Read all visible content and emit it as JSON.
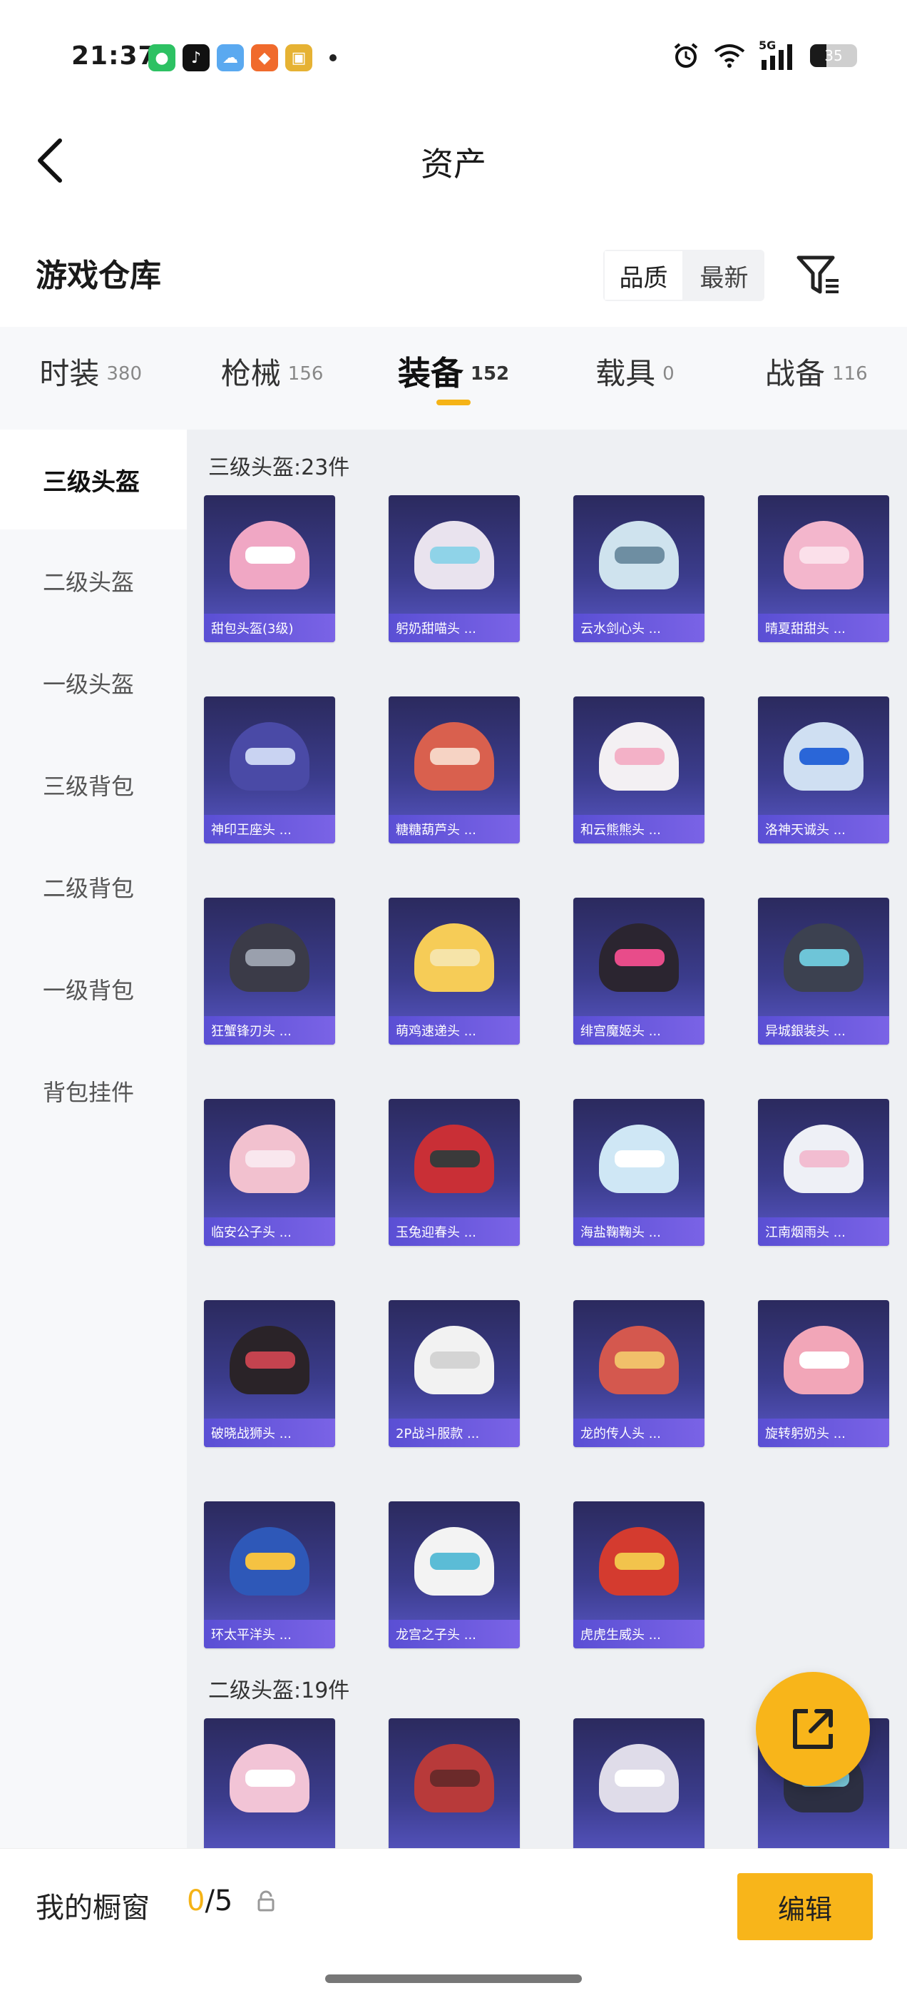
{
  "status_bar": {
    "time": "21:37",
    "battery": "35",
    "battery_level": 0.35,
    "signal": "5G",
    "icons": [
      "wechat-icon",
      "tiktok-icon",
      "weather-icon",
      "app-icon",
      "game-icon",
      "alarm-icon",
      "wifi-icon",
      "signal-icon",
      "battery-icon"
    ]
  },
  "header": {
    "title": "资产",
    "back_icon": "chevron-left-icon"
  },
  "warehouse": {
    "title": "游戏仓库",
    "sort_options": [
      "品质",
      "最新"
    ],
    "filter_icon": "filter-icon"
  },
  "category_tabs": [
    {
      "name": "时装",
      "count": "380"
    },
    {
      "name": "枪械",
      "count": "156"
    },
    {
      "name": "装备",
      "count": "152",
      "active": true
    },
    {
      "name": "载具",
      "count": "0"
    },
    {
      "name": "战备",
      "count": "116"
    }
  ],
  "sidebar": {
    "items": [
      "三级头盔",
      "二级头盔",
      "一级头盔",
      "三级背包",
      "二级背包",
      "一级背包",
      "背包挂件"
    ]
  },
  "groups": [
    {
      "label": "三级头盔:23件",
      "items": [
        {
          "name": "甜包头盔(3级)",
          "color": "#f0a7c4",
          "visor": "#ffffff"
        },
        {
          "name": "躬奶甜喵头 ...",
          "color": "#e9e3ee",
          "visor": "#8fd3e8"
        },
        {
          "name": "云水剑心头 ...",
          "color": "#cfe3ee",
          "visor": "#6e8ea2"
        },
        {
          "name": "晴夏甜甜头 ...",
          "color": "#f3b6cc",
          "visor": "#fbe0ea"
        },
        {
          "name": "神印王座头 ...",
          "color": "#4a4aa6",
          "visor": "#c9d3f2"
        },
        {
          "name": "糖糖葫芦头 ...",
          "color": "#d9604e",
          "visor": "#f6d3c4"
        },
        {
          "name": "和云熊熊头 ...",
          "color": "#f3f0f3",
          "visor": "#f3b1c7"
        },
        {
          "name": "洛神天诚头 ...",
          "color": "#cfdff2",
          "visor": "#2a66d8"
        },
        {
          "name": "狂蟹锋刃头 ...",
          "color": "#3b3b48",
          "visor": "#9aa0ad"
        },
        {
          "name": "萌鸡速递头 ...",
          "color": "#f6cc57",
          "visor": "#f6e4a9"
        },
        {
          "name": "绯宫魔姬头 ...",
          "color": "#2b2530",
          "visor": "#e84c8a"
        },
        {
          "name": "异城銀装头 ...",
          "color": "#3c4150",
          "visor": "#6ec5d8"
        },
        {
          "name": "临安公子头 ...",
          "color": "#f2c1cf",
          "visor": "#f9e7ee"
        },
        {
          "name": "玉兔迎春头 ...",
          "color": "#c92f36",
          "visor": "#3a3a3a"
        },
        {
          "name": "海盐鞠鞠头 ...",
          "color": "#cfe7f5",
          "visor": "#ffffff"
        },
        {
          "name": "江南烟雨头 ...",
          "color": "#eef0f6",
          "visor": "#f2bdd1"
        },
        {
          "name": "破晓战狮头 ...",
          "color": "#2a2328",
          "visor": "#c4434f"
        },
        {
          "name": "2P战斗服款 ...",
          "color": "#f2f2f2",
          "visor": "#d4d4d4"
        },
        {
          "name": "龙的传人头 ...",
          "color": "#d4584e",
          "visor": "#f1c06a"
        },
        {
          "name": "旋转躬奶头 ...",
          "color": "#f2a6b8",
          "visor": "#ffffff"
        },
        {
          "name": "环太平洋头 ...",
          "color": "#2e58b8",
          "visor": "#f5c242"
        },
        {
          "name": "龙宫之子头 ...",
          "color": "#f3f3f3",
          "visor": "#5bbcd6"
        },
        {
          "name": "虎虎生威头 ...",
          "color": "#d43b2f",
          "visor": "#f2c34c"
        }
      ]
    },
    {
      "label": "二级头盔:19件",
      "items": [
        {
          "name": "",
          "color": "#f2c4d6",
          "visor": "#ffffff"
        },
        {
          "name": "",
          "color": "#b83a3a",
          "visor": "#6b2a2a"
        },
        {
          "name": "",
          "color": "#dfdce9",
          "visor": "#ffffff"
        },
        {
          "name": "",
          "color": "#2c2f42",
          "visor": "#77c5d6"
        }
      ]
    }
  ],
  "fab": {
    "icon": "share-external-icon"
  },
  "bottom_bar": {
    "showcase_label": "我的橱窗",
    "showcase_current": "0",
    "showcase_total": "/5",
    "lock_icon": "lock-icon",
    "edit_label": "编辑"
  }
}
